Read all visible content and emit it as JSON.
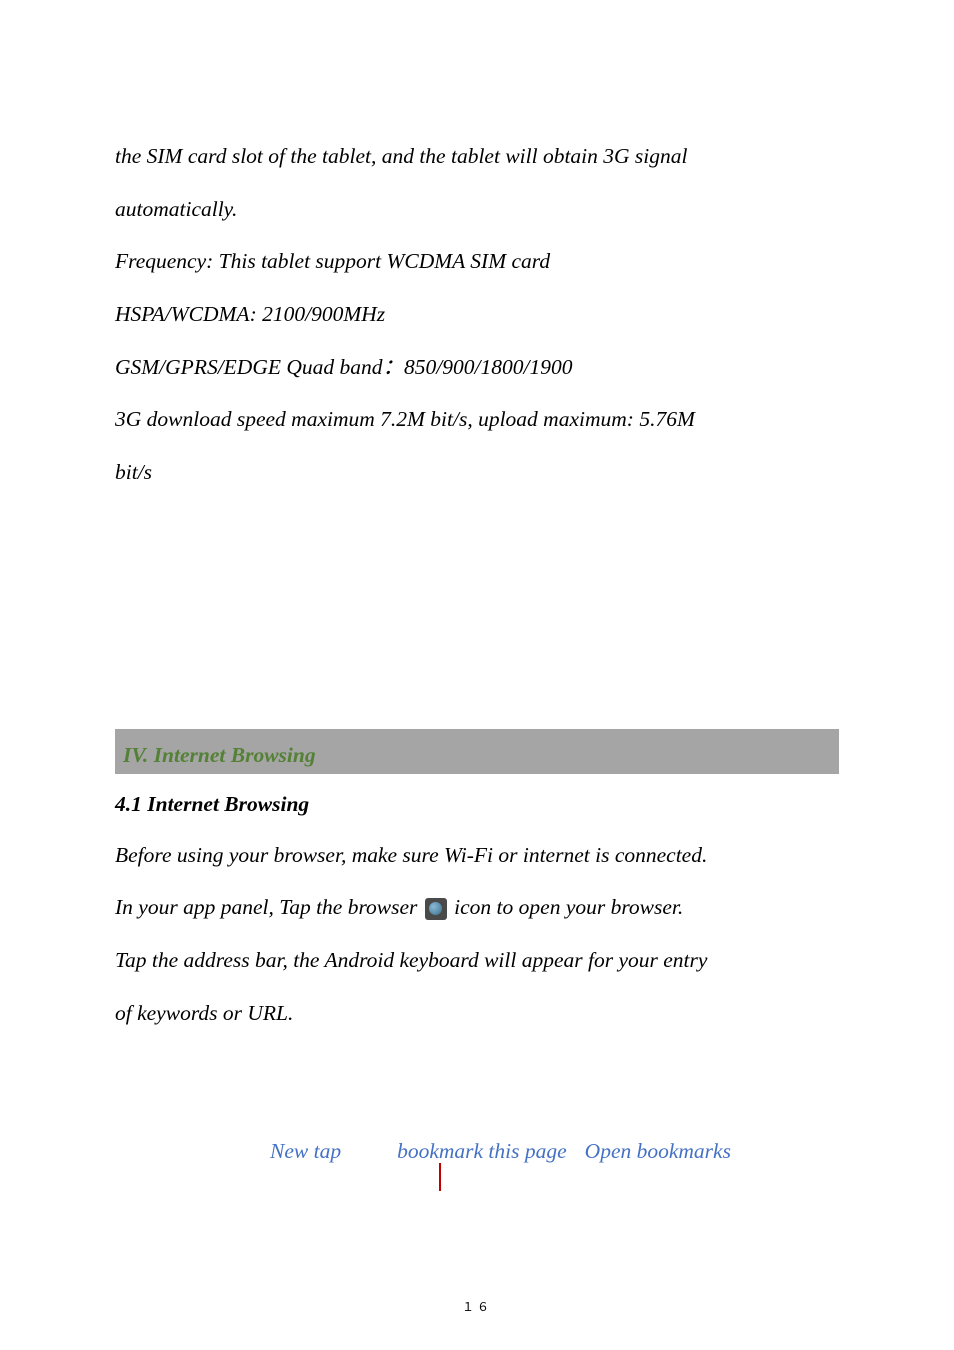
{
  "paragraphs": {
    "p1a": "the SIM card slot of the tablet, and the tablet will obtain 3G signal",
    "p1b": "automatically.",
    "p2": "Frequency: This tablet support WCDMA SIM card",
    "p3": "HSPA/WCDMA: 2100/900MHz",
    "p4": "GSM/GPRS/EDGE Quad band：850/900/1800/1900",
    "p5a": "3G download speed maximum 7.2M bit/s, upload maximum: 5.76M",
    "p5b": "bit/s"
  },
  "section_header": "IV. Internet Browsing",
  "subheading": "4.1 Internet Browsing",
  "browsing": {
    "l1": "Before using your browser, make sure Wi-Fi or internet is connected.",
    "l2a": "In your app panel, Tap the browser ",
    "l2b": " icon to open your browser.",
    "l3a": "Tap the address bar, the Android keyboard will appear for your entry",
    "l3b": "of keywords or URL."
  },
  "callouts": {
    "new_tap": "New tap",
    "bookmark": "bookmark this page",
    "open_bookmarks": "Open bookmarks"
  },
  "page_number": "１６"
}
